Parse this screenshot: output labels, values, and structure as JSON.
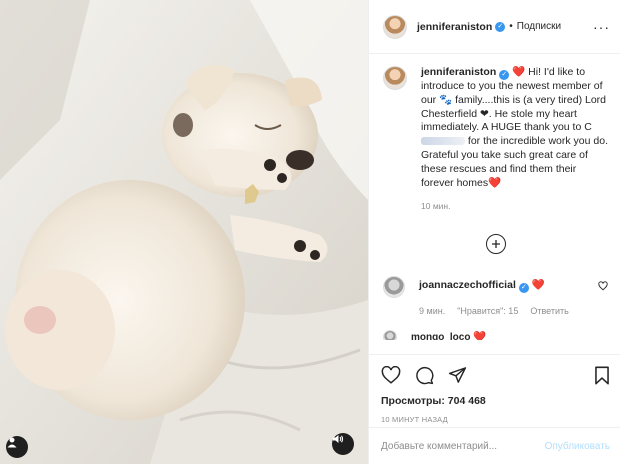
{
  "header": {
    "username": "jenniferaniston",
    "verified_mark": "✓",
    "separator": "•",
    "follow_label": "Подписки",
    "more_icon": "more-dots-icon"
  },
  "caption": {
    "username": "jenniferaniston",
    "part1": "❤️ Hi! I'd like to introduce to you the newest member of our 🐾 family....this is (a very tired) Lord Chesterfield ❤. He stole my heart immediately. A HUGE thank you to ",
    "mention_visible": "C",
    "part2": " for the incredible work you do. Grateful you take such great care of these rescues and find them their forever homes❤️",
    "time": "10 мин."
  },
  "comments": [
    {
      "username": "joannaczechofficial",
      "text": "❤️",
      "time": "9 мин.",
      "likes_label": "\"Нравится\": 15",
      "reply_label": "Ответить"
    },
    {
      "username": "mongo_loco",
      "text": "❤️"
    }
  ],
  "post": {
    "views_label": "Просмотры: 704 468",
    "timestamp": "10 МИНУТ НАЗАД"
  },
  "add_comment": {
    "placeholder": "Добавьте комментарий...",
    "publish_label": "Опубликовать"
  },
  "colors": {
    "accent": "#3897f0",
    "publish_disabled": "#b2dffc",
    "muted_text": "#8e8e8e"
  }
}
